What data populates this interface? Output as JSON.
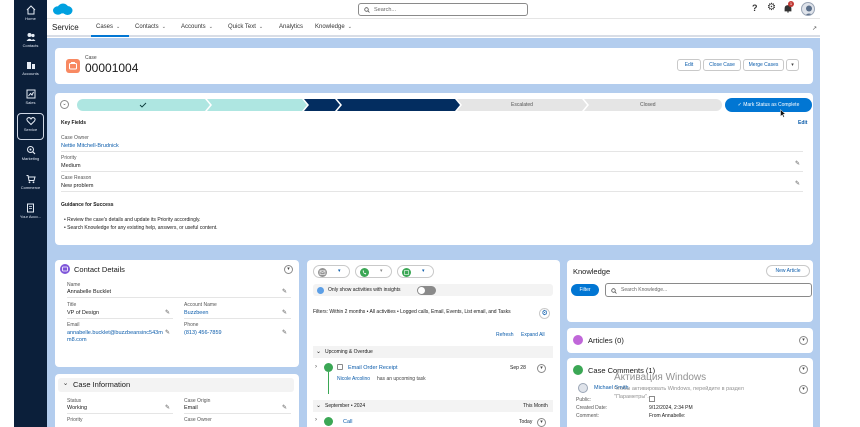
{
  "nav": {
    "items": [
      {
        "label": "Home",
        "icon": "home-icon"
      },
      {
        "label": "Contacts",
        "icon": "contacts-icon"
      },
      {
        "label": "Accounts",
        "icon": "accounts-icon"
      },
      {
        "label": "Sales",
        "icon": "sales-icon"
      },
      {
        "label": "Service",
        "icon": "heart-icon"
      },
      {
        "label": "Marketing",
        "icon": "marketing-icon"
      },
      {
        "label": "Commerce",
        "icon": "cart-icon"
      },
      {
        "label": "Your Acco...",
        "icon": "account-doc-icon"
      }
    ]
  },
  "header": {
    "search_placeholder": "Search...",
    "notification_count": "1"
  },
  "appbar": {
    "app_name": "Service",
    "tabs": [
      "Cases",
      "Contacts",
      "Accounts",
      "Quick Text",
      "Analytics",
      "Knowledge"
    ]
  },
  "case": {
    "object_label": "Case",
    "number": "00001004",
    "actions": [
      "Edit",
      "Close Case",
      "Merge Cases"
    ]
  },
  "path": {
    "stages": [
      "",
      "",
      "",
      "",
      "Escalated",
      "Closed"
    ],
    "complete_button": "Mark Status as Complete",
    "key_fields_title": "Key Fields",
    "edit_link": "Edit",
    "fields": [
      {
        "label": "Case Owner",
        "value": "Nettie Mitchell-Brudnick"
      },
      {
        "label": "Priority",
        "value": "Medium"
      },
      {
        "label": "Case Reason",
        "value": "New problem"
      }
    ],
    "guidance_title": "Guidance for Success",
    "guidance": [
      "Review the case's details and update its Priority accordingly.",
      "Search Knowledge for any existing help, answers, or useful content."
    ]
  },
  "contact": {
    "title": "Contact Details",
    "name_label": "Name",
    "name": "Annabelle Bucklet",
    "title_label": "Title",
    "job_title": "VP of Design",
    "account_label": "Account Name",
    "account": "Buzzbeen",
    "email_label": "Email",
    "email": "annabelle.bucklet@buzzbeansinc543mm8.com",
    "phone_label": "Phone",
    "phone": "(813) 456-7859"
  },
  "case_info": {
    "title": "Case Information",
    "status_label": "Status",
    "status": "Working",
    "origin_label": "Case Origin",
    "origin": "Email",
    "priority_label": "Priority",
    "owner_label": "Case Owner"
  },
  "activity": {
    "insights_toggle": "Only show activities with insights",
    "filters": "Filters: Within 2 months • All activities • Logged calls, Email, Events, List email, and Tasks",
    "refresh": "Refresh",
    "expand_all": "Expand All",
    "upcoming_title": "Upcoming & Overdue",
    "item_title": "Email Order Receipt",
    "item_date": "Sep 28",
    "item_person": "Nicole Arcolino",
    "item_desc": "has an upcoming task",
    "month_title": "September • 2024",
    "month_label": "This Month",
    "call_title": "Call",
    "call_date": "Today"
  },
  "knowledge": {
    "title": "Knowledge",
    "new_article": "New Article",
    "filter": "Filter",
    "search_placeholder": "Search Knowledge...",
    "articles": "Articles (0)",
    "comments": "Case Comments (1)",
    "comment_author": "Michael Smith",
    "public_label": "Public:",
    "created_label": "Created Date:",
    "created_value": "9/12/2024, 2:34 PM",
    "comment_label": "Comment:",
    "comment_value": "From Annabelle:"
  },
  "watermark": {
    "line1": "Активация Windows",
    "line2": "Чтобы активировать Windows, перейдите в раздел",
    "line3": "\"Параметры\"."
  },
  "colors": {
    "nav_bg": "#0b1f3a",
    "brand_blue": "#0176d3",
    "path_complete": "#aee6e1",
    "path_current": "#032d60",
    "workspace_bg": "#b3cdee"
  }
}
